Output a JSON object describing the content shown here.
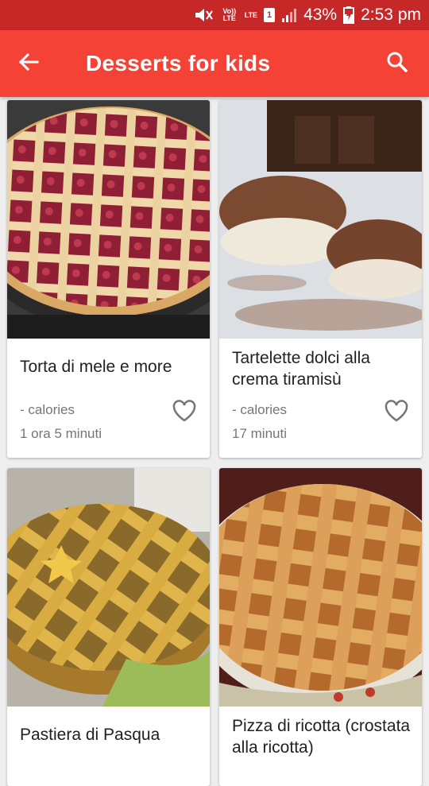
{
  "status_bar": {
    "volte": "Vo)) LTE",
    "lte": "LTE",
    "sim": "1",
    "battery": "43%",
    "time": "2:53 pm"
  },
  "app_bar": {
    "title": "Desserts for kids",
    "back_icon": "arrow-back-icon",
    "search_icon": "search-icon"
  },
  "recipes": [
    {
      "title": "Torta di mele e more",
      "calories": "- calories",
      "time": "1 ora 5 minuti",
      "image": "lattice-berry-pie"
    },
    {
      "title": "Tartelette dolci alla crema tiramisù",
      "calories": "- calories",
      "time": "17 minuti",
      "image": "chocolate-tartlets"
    },
    {
      "title": "Pastiera di Pasqua",
      "calories": "",
      "time": "",
      "image": "pastiera-pie"
    },
    {
      "title": "Pizza di ricotta (crostata alla ricotta)",
      "calories": "",
      "time": "",
      "image": "ricotta-crostata"
    }
  ],
  "colors": {
    "status_bar": "#c62828",
    "app_bar": "#f44336",
    "background": "#eeeeee"
  }
}
